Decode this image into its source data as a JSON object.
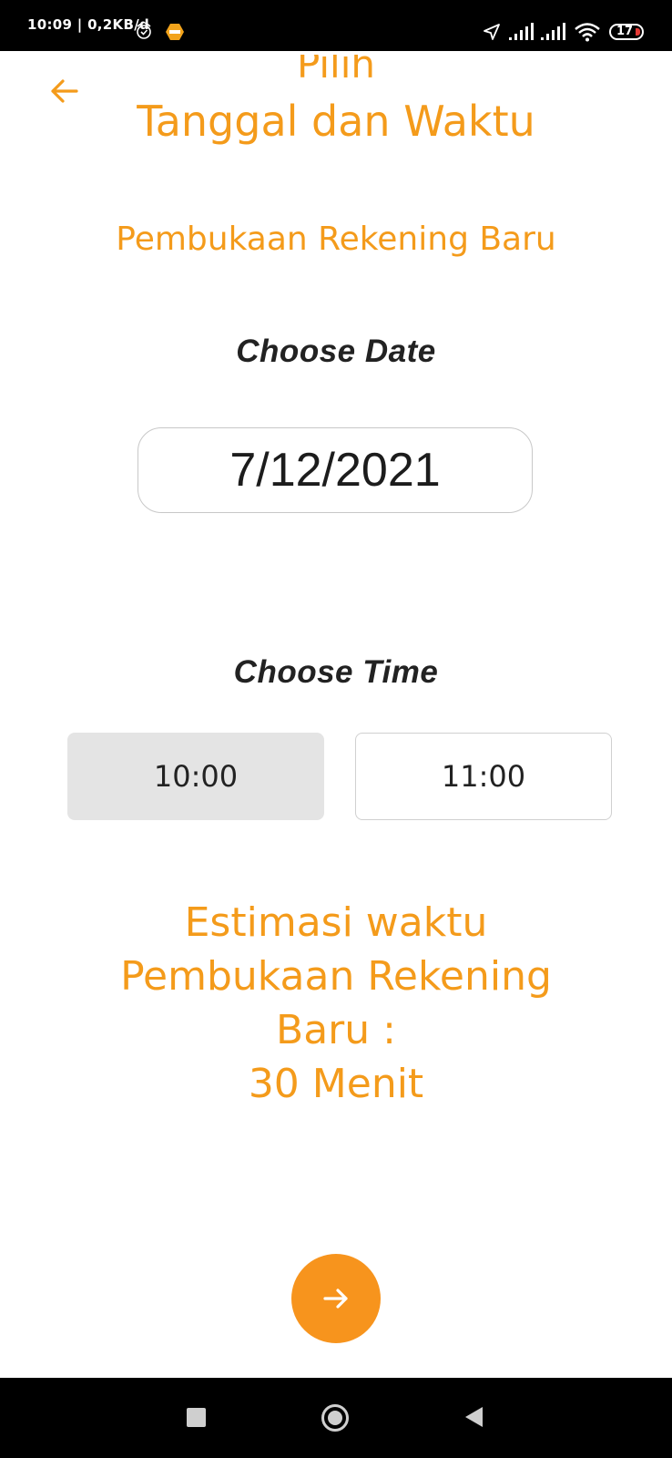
{
  "status_bar": {
    "time_info": "10:09 | 0,2KB/d",
    "battery": "17",
    "icons": [
      "alarm-icon",
      "app-notification-icon",
      "location-arrow-icon",
      "signal-icon",
      "signal-icon",
      "wifi-icon",
      "battery-icon"
    ]
  },
  "header": {
    "title_line1": "Pilih",
    "title_line2": "Tanggal dan Waktu",
    "back_icon": "arrow-left-icon"
  },
  "service_name": "Pembukaan Rekening Baru",
  "date_section": {
    "label": "Choose Date",
    "value": "7/12/2021"
  },
  "time_section": {
    "label": "Choose Time",
    "slots": [
      {
        "label": "10:00",
        "selected": true
      },
      {
        "label": "11:00",
        "selected": false
      }
    ]
  },
  "estimate": {
    "line1": "Estimasi waktu",
    "line2": "Pembukaan Rekening",
    "line3": "Baru :",
    "line4": "30 Menit"
  },
  "next_button": {
    "icon": "arrow-right-icon"
  },
  "nav_bar": {
    "icons": [
      "recents-square-icon",
      "home-circle-icon",
      "back-triangle-icon"
    ]
  },
  "colors": {
    "accent": "#F49B1B",
    "button": "#F7941D",
    "selected_slot": "#E4E4E4"
  }
}
